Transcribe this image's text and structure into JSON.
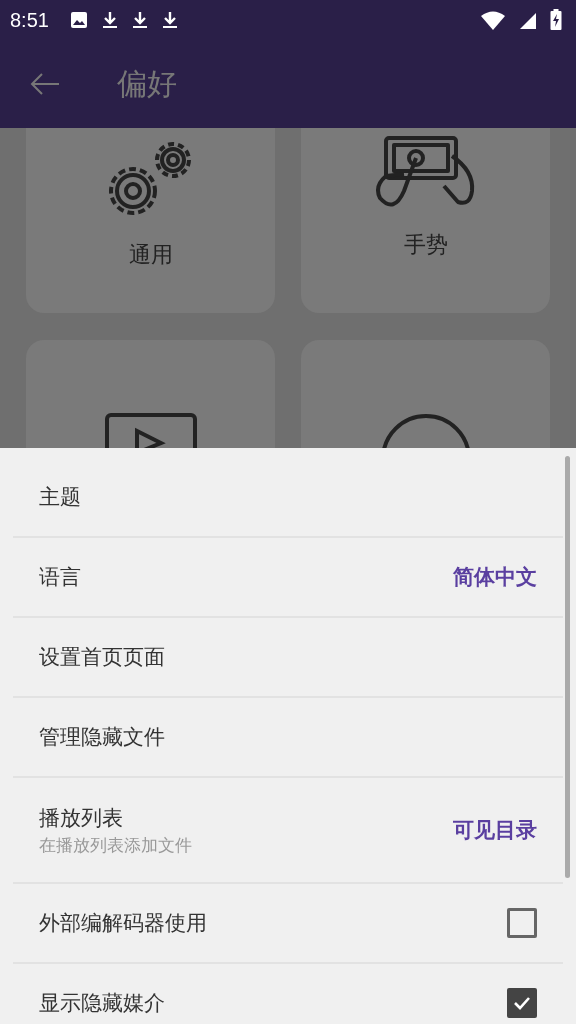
{
  "status_bar": {
    "time": "8:51"
  },
  "app_bar": {
    "title": "偏好"
  },
  "categories": [
    {
      "label": "通用"
    },
    {
      "label": "手势"
    }
  ],
  "settings": [
    {
      "kind": "plain",
      "title": "主题"
    },
    {
      "kind": "value",
      "title": "语言",
      "value": "简体中文"
    },
    {
      "kind": "plain",
      "title": "设置首页页面"
    },
    {
      "kind": "plain",
      "title": "管理隐藏文件"
    },
    {
      "kind": "value",
      "title": "播放列表",
      "subtitle": "在播放列表添加文件",
      "value": "可见目录"
    },
    {
      "kind": "checkbox",
      "title": "外部编解码器使用",
      "checked": false
    },
    {
      "kind": "checkbox",
      "title": "显示隐藏媒介",
      "checked": true
    }
  ]
}
